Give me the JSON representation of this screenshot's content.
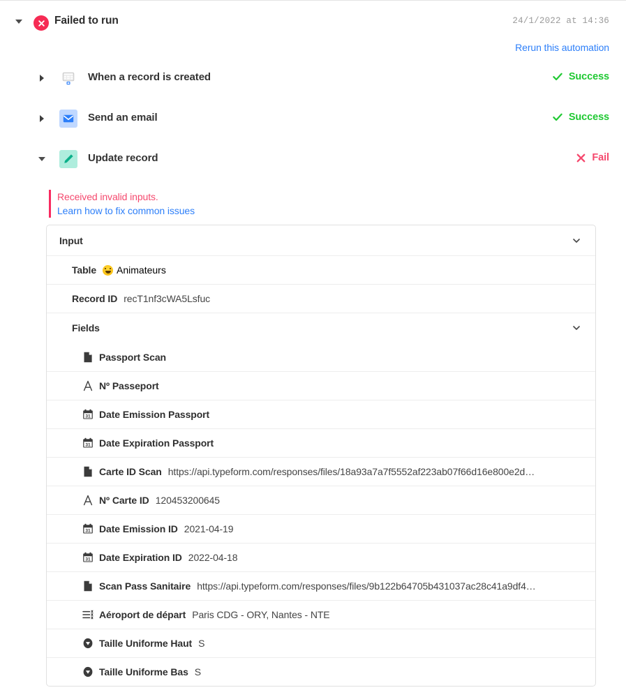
{
  "run": {
    "toggle_icon": "triangle-down-icon",
    "status_icon": "fail-circle-icon",
    "title": "Failed to run",
    "timestamp": "24/1/2022 at 14:36",
    "rerun_label": "Rerun this automation"
  },
  "steps": [
    {
      "toggle_icon": "triangle-right-icon",
      "icon": "grid-table-icon",
      "label": "When a record is created",
      "status": "Success",
      "status_icon": "check-icon",
      "status_color": "#20c933"
    },
    {
      "toggle_icon": "triangle-right-icon",
      "icon": "envelope-icon",
      "label": "Send an email",
      "status": "Success",
      "status_icon": "check-icon",
      "status_color": "#20c933"
    },
    {
      "toggle_icon": "triangle-down-icon",
      "icon": "pencil-icon",
      "label": "Update record",
      "status": "Fail",
      "status_icon": "cross-icon",
      "status_color": "#f5496e"
    }
  ],
  "error": {
    "message": "Received invalid inputs.",
    "link_label": "Learn how to fix common issues",
    "accent_color": "#f82b60",
    "link_color": "#2d7ff9"
  },
  "input_card": {
    "header": {
      "label": "Input",
      "chevron_icon": "chevron-down-icon"
    },
    "table": {
      "label": "Table",
      "emoji_icon": "smiley-emoji",
      "value": "Animateurs"
    },
    "record_id": {
      "label": "Record ID",
      "value": "recT1nf3cWA5Lsfuc"
    },
    "fields_header": {
      "label": "Fields",
      "chevron_icon": "chevron-down-icon"
    },
    "fields": [
      {
        "icon": "attachment-file-icon",
        "label": "Passport Scan",
        "value": ""
      },
      {
        "icon": "single-line-text-icon",
        "label": "Nº Passeport",
        "value": ""
      },
      {
        "icon": "calendar-date-icon",
        "label": "Date Emission Passport",
        "value": ""
      },
      {
        "icon": "calendar-date-icon",
        "label": "Date Expiration Passport",
        "value": ""
      },
      {
        "icon": "attachment-file-icon",
        "label": "Carte ID Scan",
        "value": "https://api.typeform.com/responses/files/18a93a7a7f5552af223ab07f66d16e800e2d…"
      },
      {
        "icon": "single-line-text-icon",
        "label": "Nº Carte ID",
        "value": "120453200645"
      },
      {
        "icon": "calendar-date-icon",
        "label": "Date Emission ID",
        "value": "2021-04-19"
      },
      {
        "icon": "calendar-date-icon",
        "label": "Date Expiration ID",
        "value": "2022-04-18"
      },
      {
        "icon": "attachment-file-icon",
        "label": "Scan Pass Sanitaire",
        "value": "https://api.typeform.com/responses/files/9b122b64705b431037ac28c41a9df4…"
      },
      {
        "icon": "multi-select-icon",
        "label": "Aéroport de départ",
        "value": "Paris CDG - ORY, Nantes - NTE"
      },
      {
        "icon": "single-select-icon",
        "label": "Taille Uniforme Haut",
        "value": "S"
      },
      {
        "icon": "single-select-icon",
        "label": "Taille Uniforme Bas",
        "value": "S"
      }
    ]
  }
}
